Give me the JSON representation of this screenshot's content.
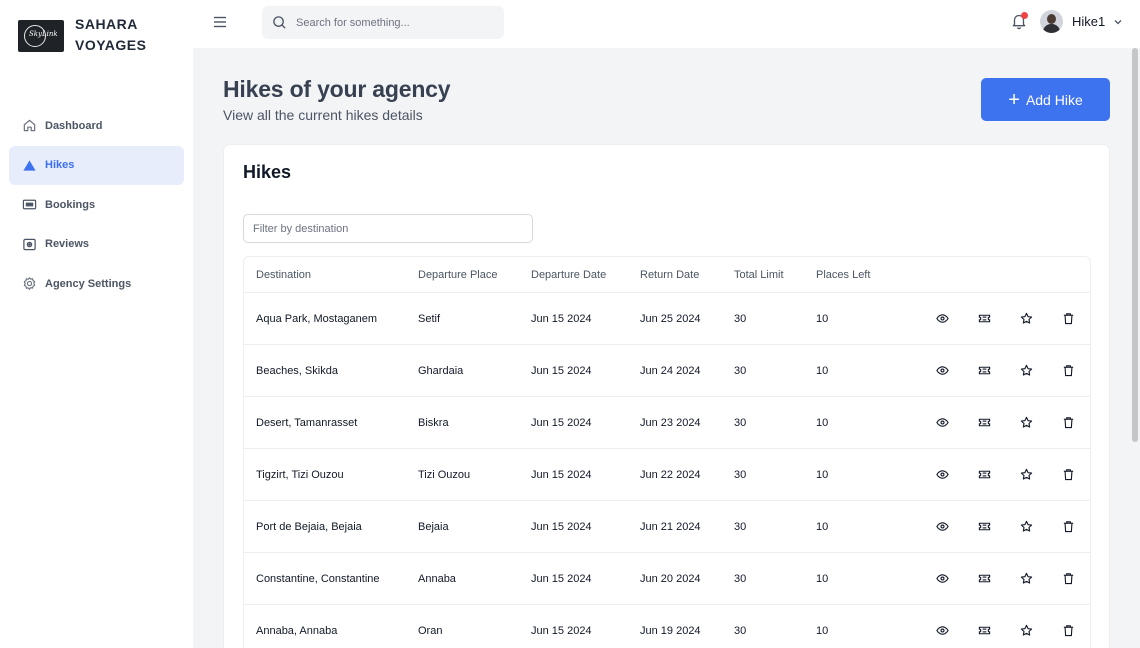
{
  "brand": {
    "line1": "SAHARA",
    "line2": "VOYAGES",
    "logo_text": "SkyLink"
  },
  "sidebar": {
    "items": [
      {
        "label": "Dashboard",
        "icon": "home-icon"
      },
      {
        "label": "Hikes",
        "icon": "mountain-icon",
        "active": true
      },
      {
        "label": "Bookings",
        "icon": "ticket-icon"
      },
      {
        "label": "Reviews",
        "icon": "review-icon"
      },
      {
        "label": "Agency Settings",
        "icon": "gear-icon"
      }
    ]
  },
  "topbar": {
    "search_placeholder": "Search for something...",
    "user_name": "Hike1"
  },
  "page": {
    "title": "Hikes of your agency",
    "subtitle": "View all the current hikes details",
    "add_button": "Add Hike"
  },
  "card": {
    "title": "Hikes",
    "filter_placeholder": "Filter by destination"
  },
  "table": {
    "headers": [
      "Destination",
      "Departure Place",
      "Departure Date",
      "Return Date",
      "Total Limit",
      "Places Left"
    ],
    "rows": [
      [
        "Aqua Park, Mostaganem",
        "Setif",
        "Jun 15 2024",
        "Jun 25 2024",
        "30",
        "10"
      ],
      [
        "Beaches, Skikda",
        "Ghardaia",
        "Jun 15 2024",
        "Jun 24 2024",
        "30",
        "10"
      ],
      [
        "Desert, Tamanrasset",
        "Biskra",
        "Jun 15 2024",
        "Jun 23 2024",
        "30",
        "10"
      ],
      [
        "Tigzirt, Tizi Ouzou",
        "Tizi Ouzou",
        "Jun 15 2024",
        "Jun 22 2024",
        "30",
        "10"
      ],
      [
        "Port de Bejaia, Bejaia",
        "Bejaia",
        "Jun 15 2024",
        "Jun 21 2024",
        "30",
        "10"
      ],
      [
        "Constantine, Constantine",
        "Annaba",
        "Jun 15 2024",
        "Jun 20 2024",
        "30",
        "10"
      ],
      [
        "Annaba, Annaba",
        "Oran",
        "Jun 15 2024",
        "Jun 19 2024",
        "30",
        "10"
      ]
    ],
    "row_actions": [
      "eye-icon",
      "ticket-icon",
      "star-icon",
      "trash-icon"
    ]
  },
  "colors": {
    "accent": "#3e73f0",
    "active_bg": "#e8edfb",
    "notification": "#ef4444"
  }
}
